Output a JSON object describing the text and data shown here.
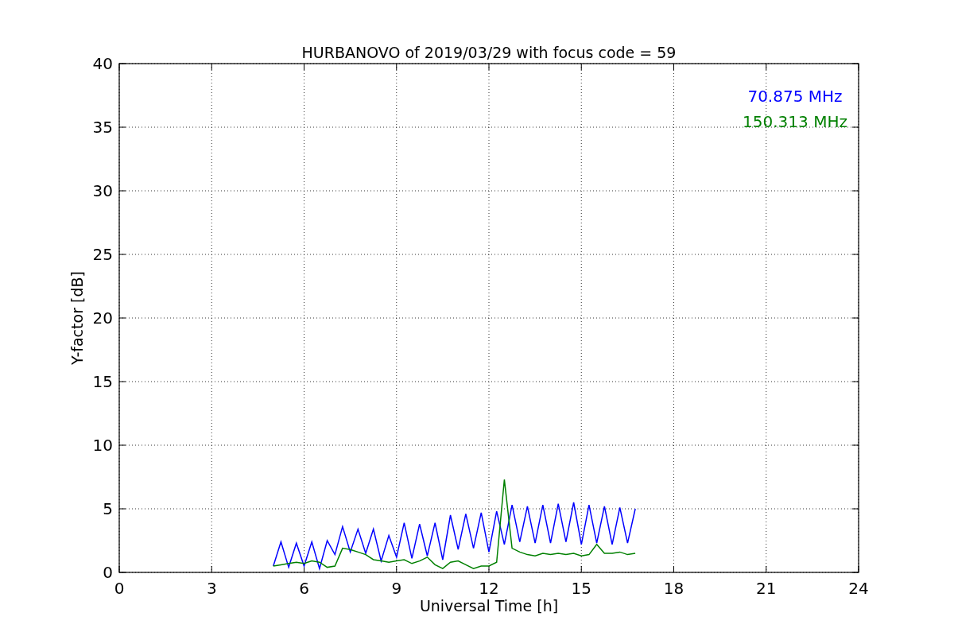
{
  "figure": {
    "chart_data": {
      "type": "line",
      "grid": true,
      "title": "HURBANOVO of 2019/03/29 with focus code = 59",
      "xlabel": "Universal Time [h]",
      "ylabel": "Y-factor [dB]",
      "xlim": [
        0,
        24
      ],
      "ylim": [
        0,
        40
      ],
      "xticks": [
        0,
        3,
        6,
        9,
        12,
        15,
        18,
        21,
        24
      ],
      "yticks": [
        0,
        5,
        10,
        15,
        20,
        25,
        30,
        35,
        40
      ],
      "x": [
        5,
        5.25,
        5.5,
        5.75,
        6,
        6.25,
        6.5,
        6.75,
        7,
        7.25,
        7.5,
        7.75,
        8,
        8.25,
        8.5,
        8.75,
        9,
        9.25,
        9.5,
        9.75,
        10,
        10.25,
        10.5,
        10.75,
        11,
        11.25,
        11.5,
        11.75,
        12,
        12.25,
        12.5,
        12.75,
        13,
        13.25,
        13.5,
        13.75,
        14,
        14.25,
        14.5,
        14.75,
        15,
        15.25,
        15.5,
        15.75,
        16,
        16.25,
        16.5,
        16.75
      ],
      "series": [
        {
          "name": "70.875 MHz",
          "color": "#0000ff",
          "values": [
            0.5,
            2.4,
            0.4,
            2.3,
            0.5,
            2.4,
            0.3,
            2.5,
            1.4,
            3.6,
            1.6,
            3.4,
            1.5,
            3.4,
            0.9,
            2.9,
            1.2,
            3.9,
            1.1,
            3.8,
            1.3,
            3.9,
            1.0,
            4.5,
            1.8,
            4.6,
            1.9,
            4.7,
            1.6,
            4.8,
            2.2,
            5.3,
            2.4,
            5.2,
            2.3,
            5.3,
            2.3,
            5.4,
            2.4,
            5.5,
            2.2,
            5.3,
            2.3,
            5.2,
            2.2,
            5.1,
            2.3,
            5.0
          ]
        },
        {
          "name": "150.313 MHz",
          "color": "#008000",
          "values": [
            0.5,
            0.6,
            0.7,
            0.8,
            0.7,
            0.9,
            0.8,
            0.4,
            0.5,
            1.9,
            1.8,
            1.6,
            1.4,
            1.0,
            0.9,
            0.8,
            0.9,
            1.0,
            0.7,
            0.9,
            1.2,
            0.6,
            0.3,
            0.8,
            0.9,
            0.6,
            0.3,
            0.5,
            0.5,
            0.8,
            7.3,
            1.9,
            1.6,
            1.4,
            1.3,
            1.5,
            1.4,
            1.5,
            1.4,
            1.5,
            1.3,
            1.4,
            2.2,
            1.5,
            1.5,
            1.6,
            1.4,
            1.5
          ]
        }
      ]
    }
  }
}
